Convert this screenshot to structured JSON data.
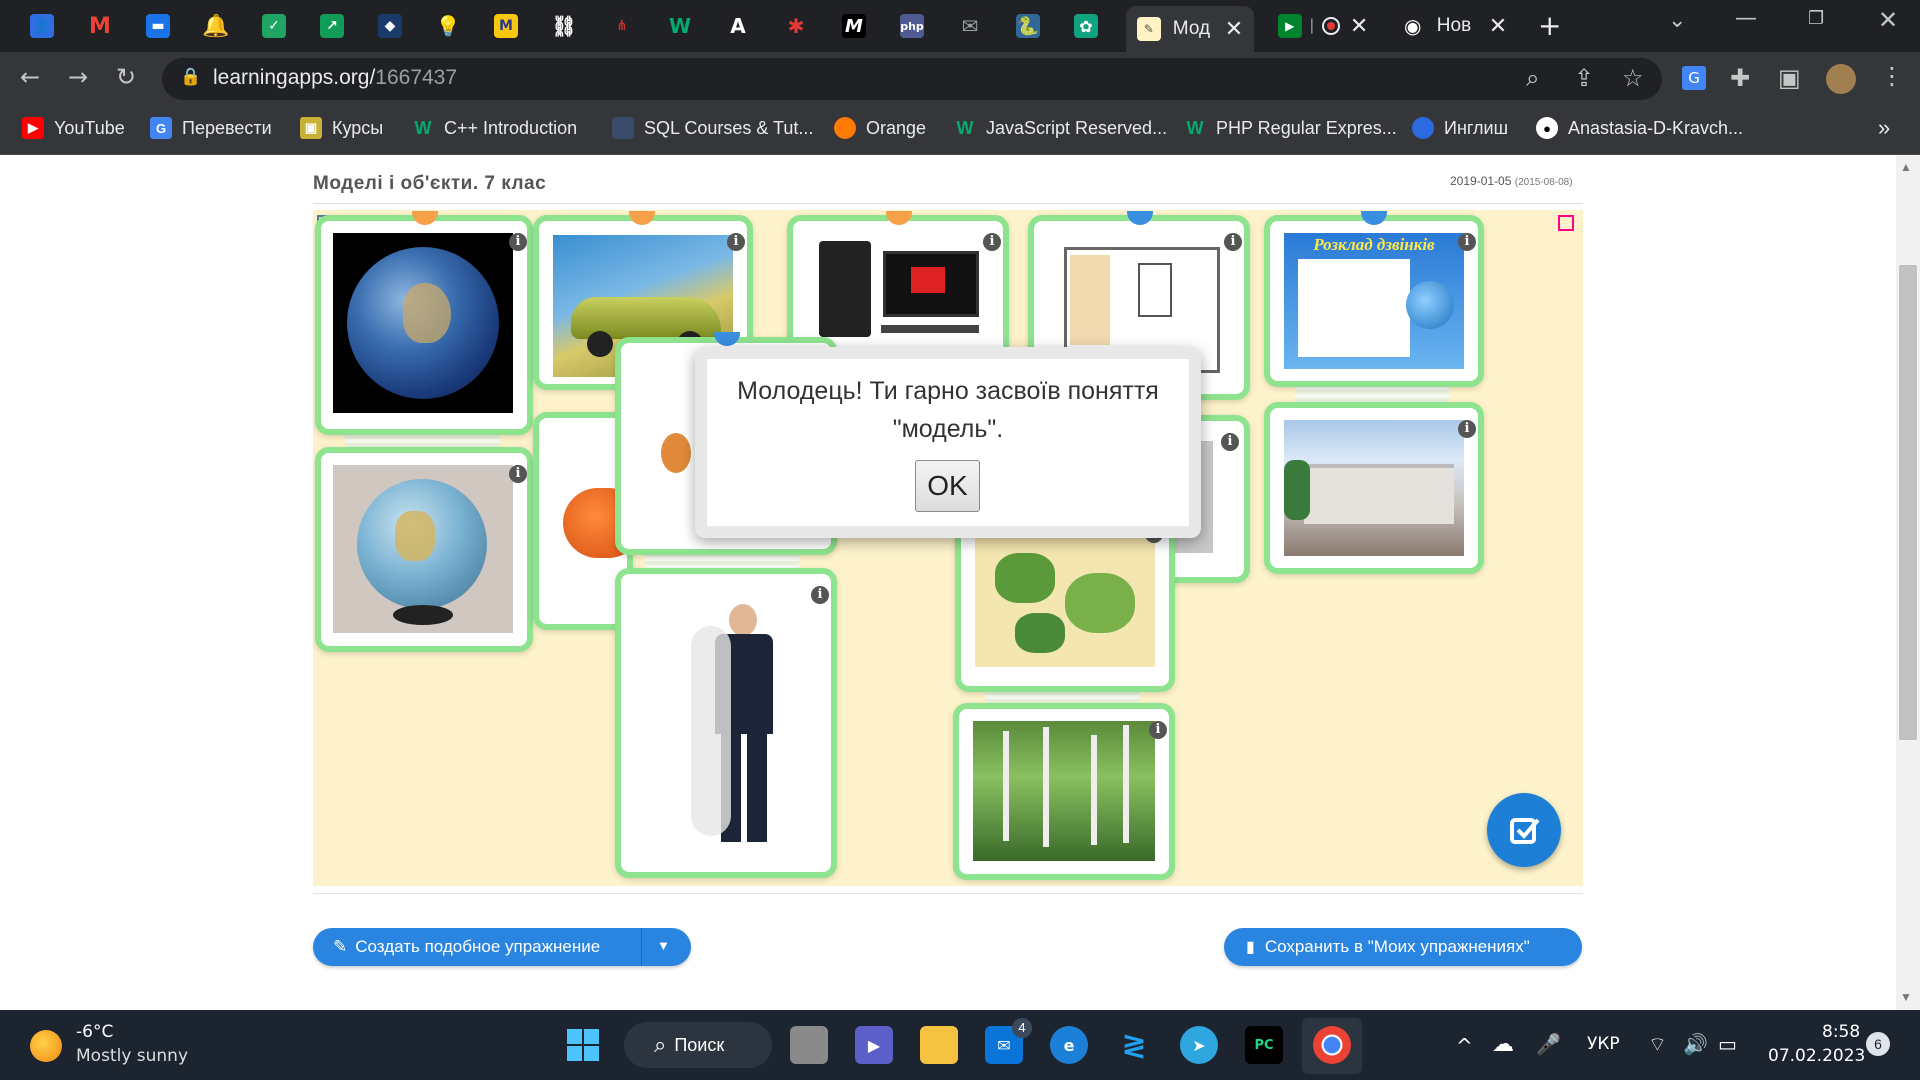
{
  "browser": {
    "tabs": [
      {
        "title": "Мод",
        "active": true
      },
      {
        "title": "Нов",
        "active": false
      }
    ],
    "url_host": "learningapps.org/",
    "url_path": "1667437"
  },
  "bookmarks": [
    {
      "label": "YouTube",
      "icon": "youtube-icon",
      "color": "#ff0000"
    },
    {
      "label": "Перевести",
      "icon": "google-translate-icon",
      "color": "#4285f4"
    },
    {
      "label": "Курсы",
      "icon": "courses-icon",
      "color": "#c9b037"
    },
    {
      "label": "C++ Introduction",
      "icon": "w3schools-icon",
      "color": "#04aa6d"
    },
    {
      "label": "SQL Courses & Tut...",
      "icon": "sql-icon",
      "color": "#3a4a6b"
    },
    {
      "label": "Orange",
      "icon": "orange-icon",
      "color": "#ff7a00"
    },
    {
      "label": "JavaScript Reserved...",
      "icon": "w3schools-icon",
      "color": "#04aa6d"
    },
    {
      "label": "PHP Regular Expres...",
      "icon": "w3schools-icon",
      "color": "#04aa6d"
    },
    {
      "label": "Инглиш",
      "icon": "person-icon",
      "color": "#2a6be0"
    },
    {
      "label": "Anastasia-D-Kravch...",
      "icon": "github-icon",
      "color": "#ffffff"
    }
  ],
  "bookmarks_more": "»",
  "app": {
    "title": "Моделі і об'єкти. 7 клас",
    "date": "2019-01-05",
    "date_created": "(2015-08-08)"
  },
  "cards": [
    {
      "name": "earth",
      "info": "i"
    },
    {
      "name": "car",
      "info": "i"
    },
    {
      "name": "computer",
      "info": "i"
    },
    {
      "name": "floor-plan",
      "info": "i"
    },
    {
      "name": "bell-schedule",
      "info": "i",
      "caption": "Розклад дзвінків"
    },
    {
      "name": "globe",
      "info": "i"
    },
    {
      "name": "school",
      "info": "i"
    },
    {
      "name": "map",
      "info": "i"
    },
    {
      "name": "man",
      "info": "i"
    },
    {
      "name": "forest",
      "info": "i"
    },
    {
      "name": "room",
      "info": "i"
    }
  ],
  "dialog": {
    "message": "Молодець! Ти гарно засвоїв поняття \"модель\".",
    "ok": "OK"
  },
  "buttons": {
    "create_similar": "Создать подобное упражнение",
    "save_mine": "Сохранить в \"Моих упражнениях\""
  },
  "taskbar": {
    "weather_temp": "-6°C",
    "weather_desc": "Mostly sunny",
    "search_label": "Поиск",
    "mail_badge": "4",
    "language": "УКР",
    "time": "8:58",
    "date": "07.02.2023",
    "notifications": "6"
  }
}
